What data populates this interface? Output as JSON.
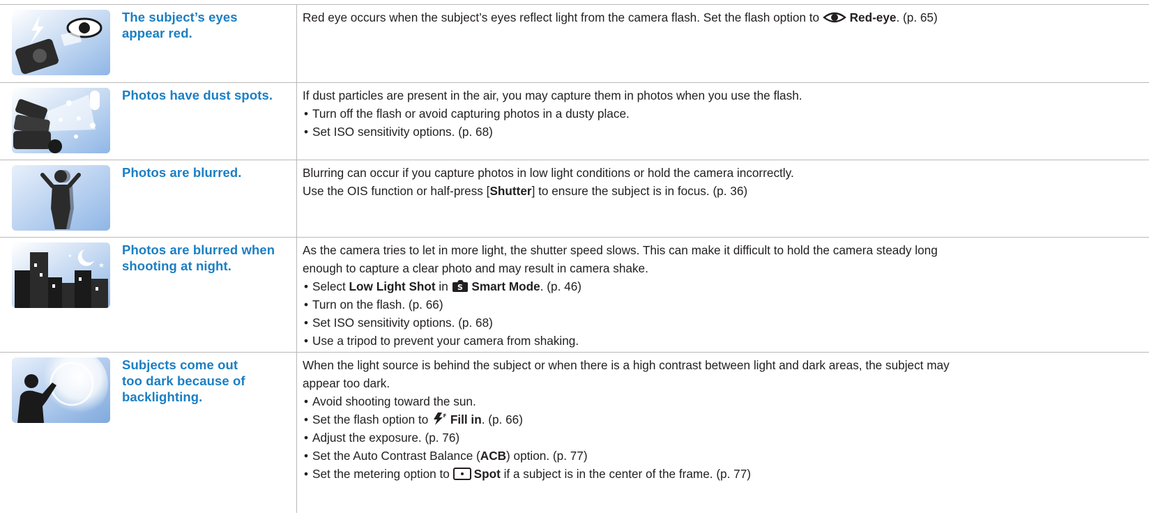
{
  "rows": [
    {
      "problem": [
        "The subject’s eyes",
        "appear red."
      ],
      "paras": [
        {
          "pre": "Red eye occurs when the subject’s eyes reflect light from the camera flash. Set the flash option to ",
          "bold": "Red-eye",
          "post": ". (p. 65)"
        }
      ]
    },
    {
      "problem": [
        "Photos have dust spots."
      ],
      "paras": [
        "If dust particles are present in the air, you may capture them in photos when you use the flash."
      ],
      "bullets": [
        "Turn off the flash or avoid capturing photos in a dusty place.",
        "Set ISO sensitivity options. (p. 68)"
      ]
    },
    {
      "problem": [
        "Photos are blurred."
      ],
      "paras": [
        "Blurring can occur if you capture photos in low light conditions or hold the camera incorrectly.",
        {
          "pre": "Use the OIS function or half-press [",
          "bold": "Shutter",
          "post": "] to ensure the subject is in focus. (p. 36)"
        }
      ]
    },
    {
      "problem": [
        "Photos are blurred when",
        "shooting at night."
      ],
      "paras": [
        "As the camera tries to let in more light, the shutter speed slows. This can make it difficult to hold the camera steady long",
        "enough to capture a clear photo and may result in camera shake."
      ],
      "bullets": [
        {
          "pre": "Select ",
          "bold": "Low Light Shot",
          "mid": " in ",
          "bold2": "Smart Mode",
          "post": ". (p. 46)"
        },
        "Turn on the flash. (p. 66)",
        "Set ISO sensitivity options. (p. 68)",
        "Use a tripod to prevent your camera from shaking."
      ]
    },
    {
      "problem": [
        "Subjects come out",
        "too dark because of",
        "backlighting."
      ],
      "paras": [
        "When the light source is behind the subject or when there is a high contrast between light and dark areas, the subject may",
        "appear too dark."
      ],
      "bullets": [
        "Avoid shooting toward the sun.",
        {
          "pre": "Set the flash option to ",
          "bold": "Fill in",
          "post": ". (p. 66)"
        },
        "Adjust the exposure. (p. 76)",
        {
          "pre": "Set the Auto Contrast Balance (",
          "bold": "ACB",
          "post": ") option. (p. 77)"
        },
        {
          "pre": "Set the metering option to ",
          "bold": "Spot",
          "post": " if a subject is in the center of the frame. (p. 77)"
        }
      ]
    }
  ],
  "bullet_char": "•",
  "colors": {
    "problem_text": "#1b7fc4",
    "body_text": "#231f20",
    "rule": "#b9b9b9"
  },
  "icons": [
    "red-eye-flash-icon",
    "smart-mode-icon",
    "fill-in-flash-icon",
    "spot-metering-icon"
  ]
}
